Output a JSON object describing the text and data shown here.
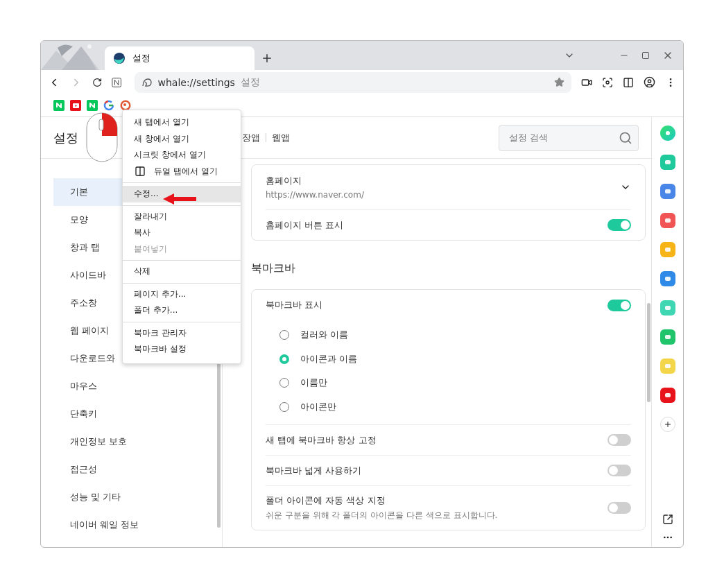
{
  "tab": {
    "title": "설정",
    "selected": true
  },
  "address": {
    "url": "whale://settings",
    "page": "설정"
  },
  "header": {
    "title": "설정",
    "nav": [
      "장앱",
      "웹앱"
    ],
    "search": {
      "placeholder": "설정 검색"
    }
  },
  "sidebar": {
    "items": [
      {
        "label": "기본",
        "selected": true
      },
      {
        "label": "모양",
        "selected": false
      },
      {
        "label": "창과 탭",
        "selected": false
      },
      {
        "label": "사이드바",
        "selected": false
      },
      {
        "label": "주소창",
        "selected": false
      },
      {
        "label": "웹 페이지",
        "selected": false
      },
      {
        "label": "다운로드와",
        "selected": false
      },
      {
        "label": "마우스",
        "selected": false
      },
      {
        "label": "단축키",
        "selected": false
      },
      {
        "label": "개인정보 보호",
        "selected": false
      },
      {
        "label": "접근성",
        "selected": false
      },
      {
        "label": "성능 및 기타",
        "selected": false
      },
      {
        "label": "네이버 웨일 정보",
        "selected": false
      }
    ]
  },
  "homepage_card": {
    "rows": [
      {
        "kind": "select",
        "label": "홈페이지",
        "value": "https://www.naver.com/"
      },
      {
        "kind": "toggle",
        "label": "홈페이지 버튼 표시",
        "on": true
      }
    ]
  },
  "bookmark_section": {
    "title": "북마크바",
    "rows": [
      {
        "kind": "toggle",
        "label": "북마크바 표시",
        "on": true
      },
      {
        "kind": "radios",
        "options": [
          {
            "label": "컬러와 이름",
            "selected": false
          },
          {
            "label": "아이콘과 이름",
            "selected": true
          },
          {
            "label": "이름만",
            "selected": false
          },
          {
            "label": "아이콘만",
            "selected": false
          }
        ]
      },
      {
        "kind": "toggle",
        "label": "새 탭에 북마크바 항상 고정",
        "on": false
      },
      {
        "kind": "toggle",
        "label": "북마크바 넓게 사용하기",
        "on": false
      },
      {
        "kind": "toggle",
        "label": "폴더 아이콘에 자동 색상 지정",
        "description": "쉬운 구분을 위해 각 폴더의 아이콘을 다른 색으로 표시합니다.",
        "on": false
      }
    ]
  },
  "context_menu": {
    "groups": [
      [
        {
          "kind": "plain",
          "label": "새 탭에서 열기",
          "selected": false,
          "disabled": false
        },
        {
          "kind": "plain",
          "label": "새 창에서 열기",
          "selected": false,
          "disabled": false
        },
        {
          "kind": "plain",
          "label": "시크릿 창에서 열기",
          "selected": false,
          "disabled": false
        },
        {
          "kind": "dual",
          "label": "듀얼 탭에서 열기",
          "selected": false,
          "disabled": false
        }
      ],
      [
        {
          "kind": "plain",
          "label": "수정...",
          "selected": true,
          "disabled": false
        }
      ],
      [
        {
          "kind": "plain",
          "label": "잘라내기",
          "selected": false,
          "disabled": false
        },
        {
          "kind": "plain",
          "label": "복사",
          "selected": false,
          "disabled": false
        },
        {
          "kind": "plain",
          "label": "붙여넣기",
          "selected": false,
          "disabled": true
        }
      ],
      [
        {
          "kind": "plain",
          "label": "삭제",
          "selected": false,
          "disabled": false
        }
      ],
      [
        {
          "kind": "plain",
          "label": "페이지 추가...",
          "selected": false,
          "disabled": false
        },
        {
          "kind": "plain",
          "label": "폴더 추가...",
          "selected": false,
          "disabled": false
        }
      ],
      [
        {
          "kind": "plain",
          "label": "북마크 관리자",
          "selected": false,
          "disabled": false
        },
        {
          "kind": "plain",
          "label": "북마크바 설정",
          "selected": false,
          "disabled": false
        }
      ]
    ]
  }
}
